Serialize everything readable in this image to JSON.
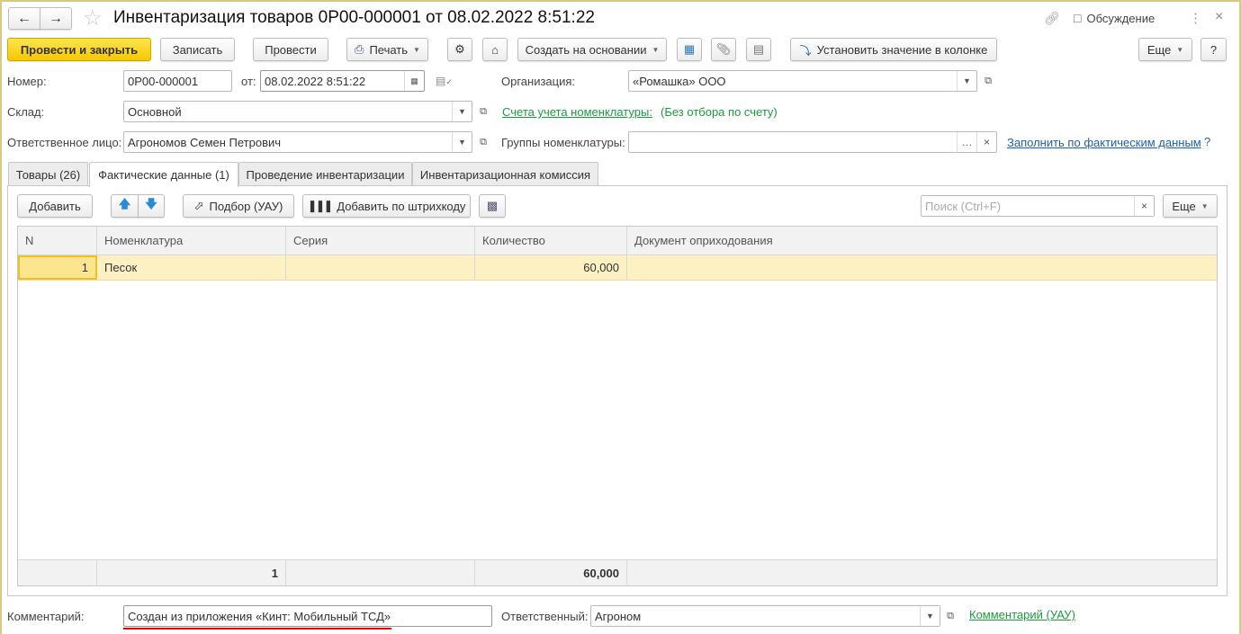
{
  "window": {
    "title": "Инвентаризация товаров 0Р00-000001 от 08.02.2022 8:51:22",
    "discussion": "Обсуждение"
  },
  "toolbar": {
    "post_close": "Провести и закрыть",
    "save": "Записать",
    "post": "Провести",
    "print": "Печать",
    "create_based": "Создать на основании",
    "set_column_value": "Установить значение в колонке",
    "more": "Еще",
    "help": "?"
  },
  "form": {
    "number_label": "Номер:",
    "number": "0Р00-000001",
    "date_label": "от:",
    "date": "08.02.2022  8:51:22",
    "org_label": "Организация:",
    "org": "«Ромашка» ООО",
    "warehouse_label": "Склад:",
    "warehouse": "Основной",
    "accounts_link": "Счета учета номенклатуры:",
    "accounts_value": "(Без отбора по счету)",
    "responsible_person_label": "Ответственное лицо:",
    "responsible_person": "Агрономов Семен Петрович",
    "groups_label": "Группы номенклатуры:",
    "groups": "",
    "fill_link": "Заполнить по фактическим данным",
    "fill_help": "?"
  },
  "tabs": [
    {
      "label": "Товары (26)"
    },
    {
      "label": "Фактические данные (1)"
    },
    {
      "label": "Проведение инвентаризации"
    },
    {
      "label": "Инвентаризационная комиссия"
    }
  ],
  "table_toolbar": {
    "add": "Добавить",
    "pick": "Подбор (УАУ)",
    "add_barcode": "Добавить по штрихкоду",
    "search_placeholder": "Поиск (Ctrl+F)",
    "more": "Еще"
  },
  "table": {
    "columns": [
      "N",
      "Номенклатура",
      "Серия",
      "Количество",
      "Документ оприходования"
    ],
    "rows": [
      {
        "n": "1",
        "item": "Песок",
        "series": "",
        "qty": "60,000",
        "doc": ""
      }
    ],
    "footer": {
      "n": "1",
      "qty": "60,000"
    }
  },
  "bottom": {
    "comment_label": "Комментарий:",
    "comment": "Создан из приложения «Кинт: Мобильный ТСД»",
    "responsible_label": "Ответственный:",
    "responsible": "Агроном",
    "comment_link": "Комментарий (УАУ)"
  },
  "colors": {
    "accent": "#f5c800",
    "link_green": "#1a9b3c",
    "link_blue": "#1c5fb1",
    "selected_row": "#fdf1c4"
  }
}
